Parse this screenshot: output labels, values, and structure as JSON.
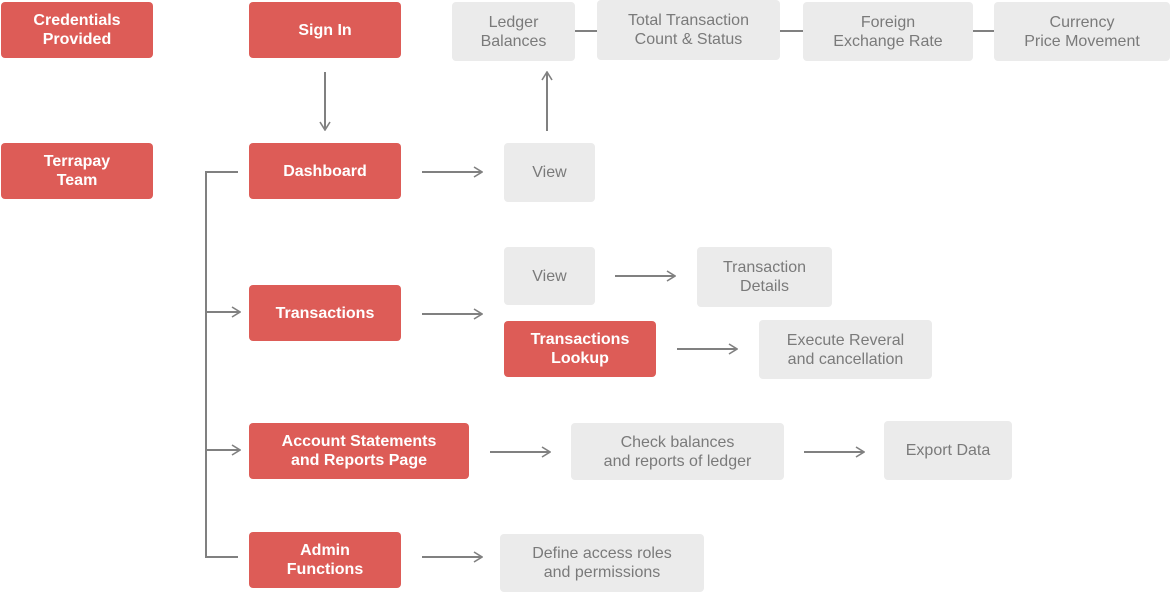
{
  "colors": {
    "primary": "#dd5c57",
    "secondary": "#ebebeb",
    "connector": "#808080",
    "secondary_text": "#7a7a7a"
  },
  "actors": {
    "credentials": "Credentials\nProvided",
    "team": "Terrapay\nTeam"
  },
  "nodes": {
    "sign_in": "Sign In",
    "dashboard": "Dashboard",
    "transactions": "Transactions",
    "account_statements": "Account Statements\nand Reports Page",
    "admin": "Admin\nFunctions",
    "dash_view": "View",
    "ledger": "Ledger\nBalances",
    "total_tx": "Total Transaction\nCount & Status",
    "fx": "Foreign\nExchange Rate",
    "currency": "Currency\nPrice Movement",
    "tx_view": "View",
    "tx_details": "Transaction\nDetails",
    "tx_lookup": "Transactions\nLookup",
    "reversal": "Execute Reveral\nand cancellation",
    "check_balances": "Check balances\nand reports of ledger",
    "export": "Export Data",
    "access_roles": "Define access roles\nand permissions"
  }
}
